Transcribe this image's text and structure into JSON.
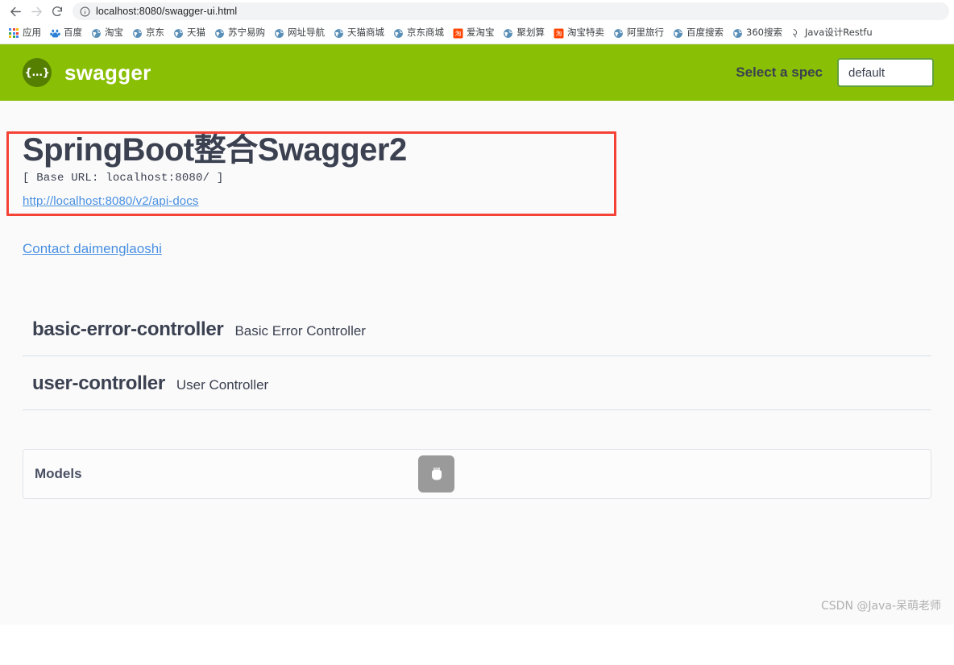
{
  "browser": {
    "nav": {
      "back_icon": "back-arrow-icon",
      "forward_icon": "forward-arrow-icon",
      "reload_icon": "reload-icon"
    },
    "omnibox": {
      "info_icon": "info-circle-icon",
      "url_host": "localhost:8080",
      "url_path": "/swagger-ui.html",
      "url_full": "localhost:8080/swagger-ui.html"
    },
    "bookmarks": [
      {
        "label": "应用",
        "icon": "apps-grid-icon"
      },
      {
        "label": "百度",
        "icon": "baidu-paw-icon"
      },
      {
        "label": "淘宝",
        "icon": "globe-icon"
      },
      {
        "label": "京东",
        "icon": "globe-icon"
      },
      {
        "label": "天猫",
        "icon": "globe-icon"
      },
      {
        "label": "苏宁易购",
        "icon": "globe-icon"
      },
      {
        "label": "网址导航",
        "icon": "globe-icon"
      },
      {
        "label": "天猫商城",
        "icon": "globe-icon"
      },
      {
        "label": "京东商城",
        "icon": "globe-icon"
      },
      {
        "label": "爱淘宝",
        "icon": "taobao-icon"
      },
      {
        "label": "聚划算",
        "icon": "globe-icon"
      },
      {
        "label": "淘宝特卖",
        "icon": "taobao-icon"
      },
      {
        "label": "阿里旅行",
        "icon": "globe-icon"
      },
      {
        "label": "百度搜索",
        "icon": "globe-icon"
      },
      {
        "label": "360搜索",
        "icon": "globe-icon"
      },
      {
        "label": "Java设计Restfu",
        "icon": "bookmark-page-icon"
      }
    ]
  },
  "swagger_header": {
    "logo_icon": "swagger-braces-icon",
    "logo_text": "{...}",
    "wordmark": "swagger",
    "spec_label": "Select a spec",
    "spec_selected": "default",
    "brand_green": "#89bf04",
    "logo_green": "#547f00"
  },
  "info": {
    "title": "SpringBoot整合Swagger2",
    "base_url": "[ Base URL: localhost:8080/ ]",
    "docs_link": "http://localhost:8080/v2/api-docs",
    "contact_link": "Contact daimenglaoshi",
    "annotation_color": "#f44336"
  },
  "tags": [
    {
      "name": "basic-error-controller",
      "description": "Basic Error Controller"
    },
    {
      "name": "user-controller",
      "description": "User Controller"
    }
  ],
  "models": {
    "title": "Models",
    "toggle_icon": "models-expand-icon"
  },
  "watermark": "CSDN @Java-呆萌老师"
}
